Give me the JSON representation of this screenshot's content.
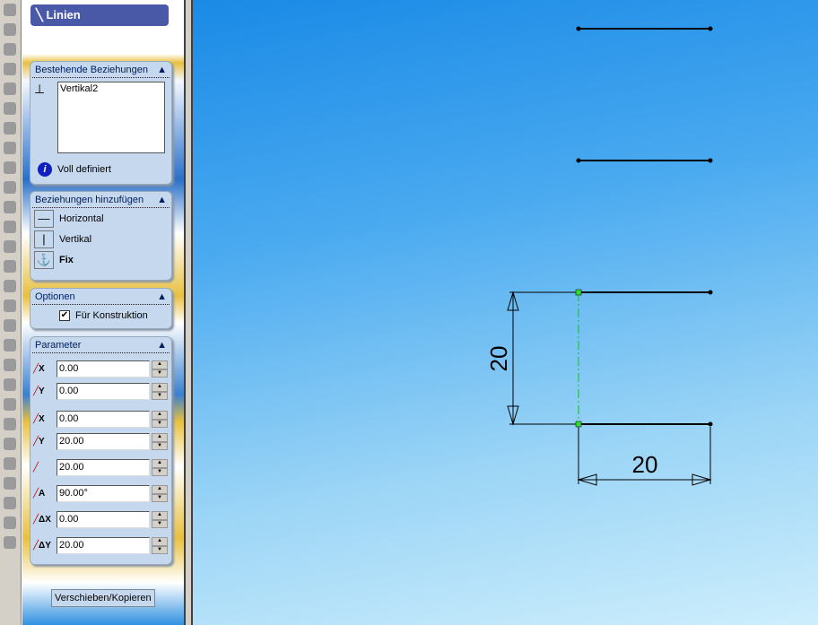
{
  "property_manager": {
    "title": "Linien"
  },
  "existing_relations": {
    "header": "Bestehende Beziehungen",
    "items": [
      "Vertikal2"
    ],
    "status": "Voll definiert"
  },
  "add_relations": {
    "header": "Beziehungen hinzufügen",
    "items": [
      "Horizontal",
      "Vertikal",
      "Fix"
    ]
  },
  "options": {
    "header": "Optionen",
    "construction_label": "Für Konstruktion",
    "construction_checked": true
  },
  "parameters": {
    "header": "Parameter",
    "fields": [
      {
        "icon": "start-x",
        "sub": "X",
        "value": "0.00"
      },
      {
        "icon": "start-y",
        "sub": "Y",
        "value": "0.00"
      },
      {
        "icon": "end-x",
        "sub": "X",
        "value": "0.00"
      },
      {
        "icon": "end-y",
        "sub": "Y",
        "value": "20.00"
      },
      {
        "icon": "length",
        "sub": "",
        "value": "20.00"
      },
      {
        "icon": "angle",
        "sub": "A",
        "value": "90.00°"
      },
      {
        "icon": "delta-x",
        "sub": "ΔX",
        "value": "0.00"
      },
      {
        "icon": "delta-y",
        "sub": "ΔY",
        "value": "20.00"
      }
    ]
  },
  "tooltip": "Verschieben/Kopieren",
  "sketch": {
    "dim_vertical": "20",
    "dim_horizontal": "20"
  }
}
